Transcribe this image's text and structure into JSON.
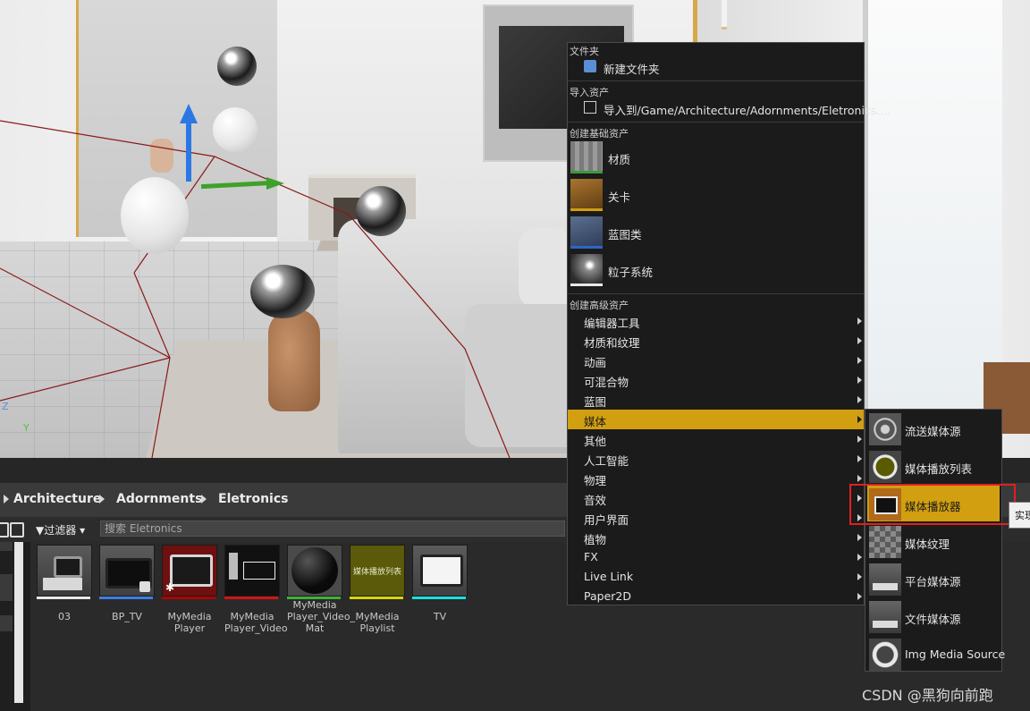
{
  "breadcrumb": {
    "items": [
      "Architecture",
      "Adornments",
      "Eletronics"
    ]
  },
  "filter": {
    "label": "过滤器",
    "search_placeholder": "搜索 Eletronics"
  },
  "viewport": {
    "axis_z": "Z",
    "axis_y": "Y"
  },
  "assets": [
    {
      "name": "03",
      "bar_color": "#e8e8e8"
    },
    {
      "name": "BP_TV",
      "bar_color": "#3d7ee6"
    },
    {
      "name": "MyMedia Player",
      "bar_color": "#b00000"
    },
    {
      "name": "MyMedia Player_Video",
      "bar_color": "#d21414"
    },
    {
      "name": "MyMedia Player_Video_ Mat",
      "bar_color": "#3bb33b"
    },
    {
      "name": "MyMedia Playlist",
      "thumb_text": "媒体播放列表",
      "bar_color": "#dcd600"
    },
    {
      "name": "TV",
      "bar_color": "#18e0e0"
    }
  ],
  "context_menu": {
    "folder_header": "文件夹",
    "new_folder": "新建文件夹",
    "import_header": "导入资产",
    "import_to": "导入到/Game/Architecture/Adornments/Eletronics....",
    "basic_header": "创建基础资产",
    "basic_items": [
      {
        "label": "材质",
        "icon": "material-icon",
        "stripe": "#3b9a3b"
      },
      {
        "label": "关卡",
        "icon": "level-icon",
        "stripe": "#d19f10"
      },
      {
        "label": "蓝图类",
        "icon": "blueprint-icon",
        "stripe": "#2f66c6"
      },
      {
        "label": "粒子系统",
        "icon": "particle-icon",
        "stripe": "#e8e8e8"
      }
    ],
    "advanced_header": "创建高级资产",
    "advanced_items": [
      "编辑器工具",
      "材质和纹理",
      "动画",
      "可混合物",
      "蓝图",
      "媒体",
      "其他",
      "人工智能",
      "物理",
      "音效",
      "用户界面",
      "植物",
      "FX",
      "Live Link",
      "Paper2D"
    ],
    "active_item": "媒体"
  },
  "sub_menu": {
    "items": [
      {
        "label": "流送媒体源",
        "icon": "stream-media-icon"
      },
      {
        "label": "媒体播放列表",
        "icon": "media-playlist-icon"
      },
      {
        "label": "媒体播放器",
        "icon": "media-player-icon"
      },
      {
        "label": "媒体纹理",
        "icon": "media-texture-icon"
      },
      {
        "label": "平台媒体源",
        "icon": "platform-media-icon"
      },
      {
        "label": "文件媒体源",
        "icon": "file-media-icon"
      },
      {
        "label": "Img Media Source",
        "icon": "img-media-icon"
      }
    ],
    "active_item": "媒体播放器"
  },
  "tooltip": {
    "text": "实现"
  },
  "watermark": "CSDN @黑狗向前跑"
}
